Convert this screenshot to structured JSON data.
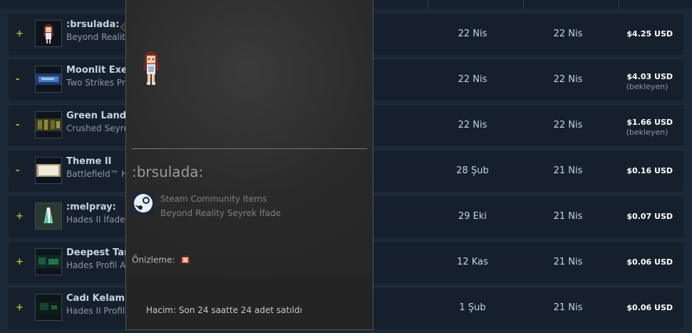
{
  "rows": [
    {
      "sign": "+",
      "name": ":brsulada:",
      "game": "Beyond Reality",
      "date_listed": "22 Nis",
      "date_action": "22 Nis",
      "price": "$4.25 USD",
      "pending": ""
    },
    {
      "sign": "-",
      "name": "Moonlit Exec",
      "game": "Two Strikes Pro",
      "date_listed": "22 Nis",
      "date_action": "22 Nis",
      "price": "$4.03 USD",
      "pending": "(bekleyen)"
    },
    {
      "sign": "-",
      "name": "Green Lands",
      "game": "Crushed Seyre",
      "date_listed": "22 Nis",
      "date_action": "22 Nis",
      "price": "$1.66 USD",
      "pending": "(bekleyen)"
    },
    {
      "sign": "-",
      "name": "Theme II",
      "game": "Battlefield™ H",
      "date_listed": "28 Şub",
      "date_action": "21 Nis",
      "price": "$0.16 USD",
      "pending": ""
    },
    {
      "sign": "+",
      "name": ":melpray:",
      "game": "Hades II İfade",
      "date_listed": "29 Eki",
      "date_action": "21 Nis",
      "price": "$0.07 USD",
      "pending": ""
    },
    {
      "sign": "+",
      "name": "Deepest Tar",
      "game": "Hades Profil Ar",
      "date_listed": "12 Kas",
      "date_action": "21 Nis",
      "price": "$0.06 USD",
      "pending": ""
    },
    {
      "sign": "+",
      "name": "Cadı Kelamı",
      "game": "Hades II Profil",
      "date_listed": "1 Şub",
      "date_action": "21 Nis",
      "price": "$0.06 USD",
      "pending": ""
    }
  ],
  "popup": {
    "title": ":brsulada:",
    "type_line1": "Steam Community Items",
    "type_line2": "Beyond Reality Seyrek İfade",
    "preview_label": "Önizleme:",
    "volume": "Hacim: Son 24 saatte 24 adet satıldı"
  },
  "icons": {
    "steam": "steam-logo-icon"
  },
  "colors": {
    "background": "#1b2838",
    "row": "#16202d",
    "accent_sign": "#9fbf3a",
    "popup": "#262626"
  }
}
